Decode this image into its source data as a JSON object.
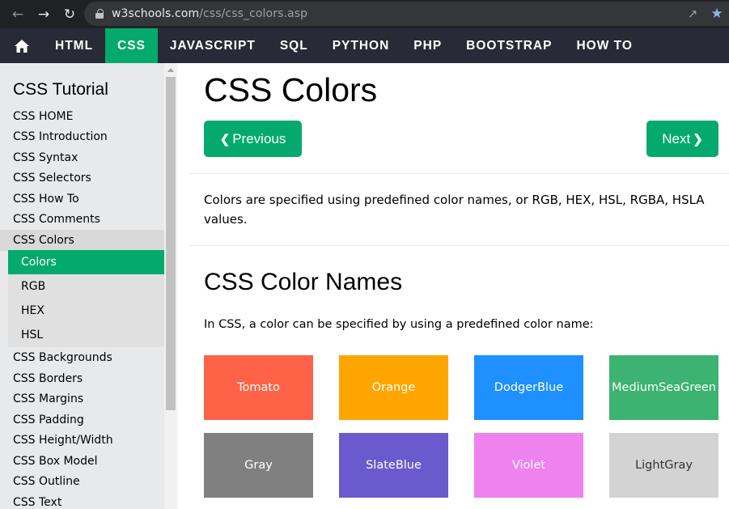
{
  "browser": {
    "url_host": "w3schools.com",
    "url_path": "/css/css_colors.asp"
  },
  "topnav": {
    "items": [
      {
        "label": "HTML",
        "active": false
      },
      {
        "label": "CSS",
        "active": true
      },
      {
        "label": "JAVASCRIPT",
        "active": false
      },
      {
        "label": "SQL",
        "active": false
      },
      {
        "label": "PYTHON",
        "active": false
      },
      {
        "label": "PHP",
        "active": false
      },
      {
        "label": "BOOTSTRAP",
        "active": false
      },
      {
        "label": "HOW TO",
        "active": false
      }
    ],
    "accent_color": "#04aa6d",
    "background": "#282a35"
  },
  "sidebar": {
    "title": "CSS Tutorial",
    "links_top": [
      "CSS HOME",
      "CSS Introduction",
      "CSS Syntax",
      "CSS Selectors",
      "CSS How To",
      "CSS Comments",
      "CSS Colors"
    ],
    "sub_links": [
      {
        "label": "Colors",
        "active": true
      },
      {
        "label": "RGB",
        "active": false
      },
      {
        "label": "HEX",
        "active": false
      },
      {
        "label": "HSL",
        "active": false
      }
    ],
    "links_bottom": [
      "CSS Backgrounds",
      "CSS Borders",
      "CSS Margins",
      "CSS Padding",
      "CSS Height/Width",
      "CSS Box Model",
      "CSS Outline",
      "CSS Text"
    ]
  },
  "main": {
    "title": "CSS Colors",
    "prev_label": "Previous",
    "next_label": "Next",
    "intro": "Colors are specified using predefined color names, or RGB, HEX, HSL, RGBA, HSLA values.",
    "section_title": "CSS Color Names",
    "section_text": "In CSS, a color can be specified by using a predefined color name:",
    "swatches": [
      {
        "name": "Tomato",
        "color": "#ff6347"
      },
      {
        "name": "Orange",
        "color": "#ffa500"
      },
      {
        "name": "DodgerBlue",
        "color": "#1e90ff"
      },
      {
        "name": "MediumSeaGreen",
        "color": "#3cb371"
      },
      {
        "name": "Gray",
        "color": "#808080"
      },
      {
        "name": "SlateBlue",
        "color": "#6a5acd"
      },
      {
        "name": "Violet",
        "color": "#ee82ee"
      },
      {
        "name": "LightGray",
        "color": "#d3d3d3"
      }
    ]
  }
}
